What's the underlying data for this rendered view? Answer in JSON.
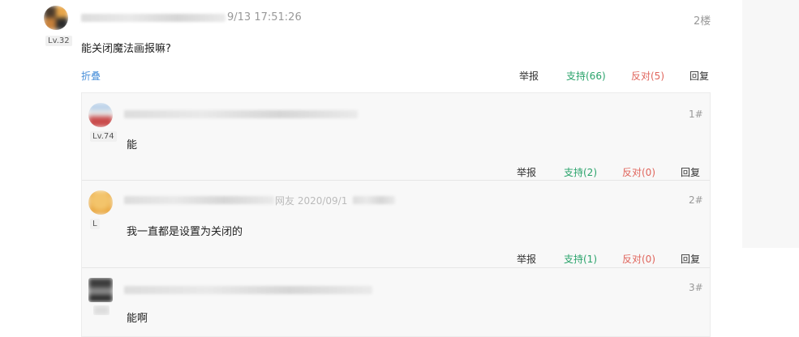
{
  "post": {
    "timestamp": "9/13 17:51:26",
    "floor": "2楼",
    "level": "Lv.32",
    "content": "能关闭魔法画报嘛?",
    "fold_label": "折叠",
    "report_label": "举报",
    "support_label": "支持(66)",
    "oppose_label": "反对(5)",
    "reply_label": "回复"
  },
  "replies": [
    {
      "level": "Lv.74",
      "floor": "1#",
      "content": "能",
      "meta_partial": "",
      "report_label": "举报",
      "support_label": "支持(2)",
      "oppose_label": "反对(0)",
      "reply_label": "回复"
    },
    {
      "level": "L",
      "floor": "2#",
      "content": "我一直都是设置为关闭的",
      "meta_partial": "网友 2020/09/1",
      "report_label": "举报",
      "support_label": "支持(1)",
      "oppose_label": "反对(0)",
      "reply_label": "回复"
    },
    {
      "level": "",
      "floor": "3#",
      "content": "能啊",
      "meta_partial": "",
      "report_label": "",
      "support_label": "",
      "oppose_label": "",
      "reply_label": ""
    }
  ],
  "colors": {
    "support": "#2aa36b",
    "oppose": "#e0655c",
    "fold": "#4a90d9"
  }
}
